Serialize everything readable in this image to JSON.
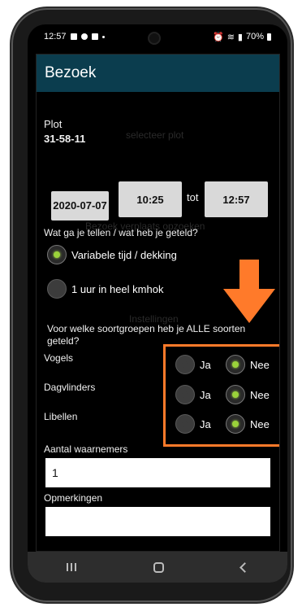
{
  "statusbar": {
    "time": "12:57",
    "battery": "70%"
  },
  "appbar": {
    "title": "Bezoek"
  },
  "ghost": {
    "line1": "selecteer plot",
    "line2": "Bezoek verplaats opzoeken",
    "line3": "Instellingen"
  },
  "plot": {
    "label": "Plot",
    "value": "31-58-11"
  },
  "time_row": {
    "date": "2020-07-07",
    "start": "10:25",
    "tot": "tot",
    "end": "12:57"
  },
  "question": "Wat ga je tellen / wat heb je geteld?",
  "options": [
    {
      "label": "Variabele tijd / dekking",
      "selected": true
    },
    {
      "label": "1 uur in heel kmhok",
      "selected": false
    }
  ],
  "groups_question": "Voor welke soortgroepen heb je ALLE soorten geteld?",
  "groups": [
    {
      "name": "Vogels",
      "ja": "Ja",
      "nee": "Nee",
      "selected": "nee"
    },
    {
      "name": "Dagvlinders",
      "ja": "Ja",
      "nee": "Nee",
      "selected": "nee"
    },
    {
      "name": "Libellen",
      "ja": "Ja",
      "nee": "Nee",
      "selected": "nee"
    }
  ],
  "observers": {
    "label": "Aantal waarnemers",
    "value": "1"
  },
  "remarks": {
    "label": "Opmerkingen",
    "value": ""
  },
  "colors": {
    "appbar": "#0b3d4e",
    "highlight": "#ff7a2a",
    "radio_on": "#9ad33a"
  }
}
